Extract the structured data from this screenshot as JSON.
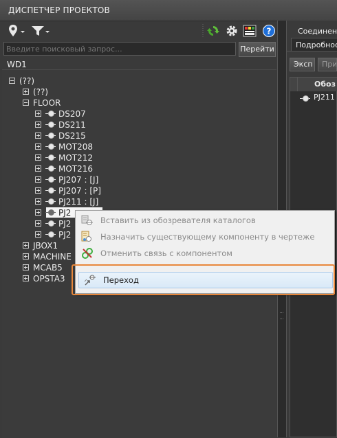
{
  "title": "ДИСПЕТЧЕР ПРОЕКТОВ",
  "toolbar": {
    "icons": [
      "location-pin-icon",
      "filter-icon",
      "refresh-icon",
      "gear-icon",
      "palette-icon",
      "help-icon"
    ]
  },
  "search": {
    "placeholder": "Введите поисковый запрос...",
    "go_label": "Перейти"
  },
  "project": "WD1",
  "tree": {
    "root": "(??)",
    "child_unknown": "(??)",
    "floor": "FLOOR",
    "floor_items": [
      "DS207",
      "DS211",
      "DS215",
      "MOT208",
      "MOT212",
      "MOT216",
      "PJ207 : [J]",
      "PJ207 : [P]",
      "PJ211 : [J]",
      "PJ2",
      "PJ2",
      "PJ2"
    ],
    "others": [
      "JBOX1",
      "MACHINE",
      "MCAB5",
      "OPSTA3"
    ]
  },
  "right_panel": {
    "tab1": "Соединени",
    "tab2": "Подробнос",
    "btn1": "Эксп",
    "btn2": "При",
    "col_header": "Обоз",
    "row1": "PJ211"
  },
  "context_menu": {
    "items": [
      {
        "label": "Вставить из обозревателя каталогов",
        "icon": "insert-catalog-icon",
        "enabled": false
      },
      {
        "label": "Назначить существующему компоненту в чертеже",
        "icon": "assign-component-icon",
        "enabled": false
      },
      {
        "label": "Отменить связь с компонентом",
        "icon": "unlink-icon",
        "enabled": false
      },
      {
        "label": "Переход",
        "icon": "navigate-icon",
        "enabled": true,
        "highlighted": true
      }
    ]
  },
  "colors": {
    "highlight_border": "#e8873a",
    "menu_bg": "#f0f0f0",
    "panel_bg": "#3a3a3a"
  }
}
